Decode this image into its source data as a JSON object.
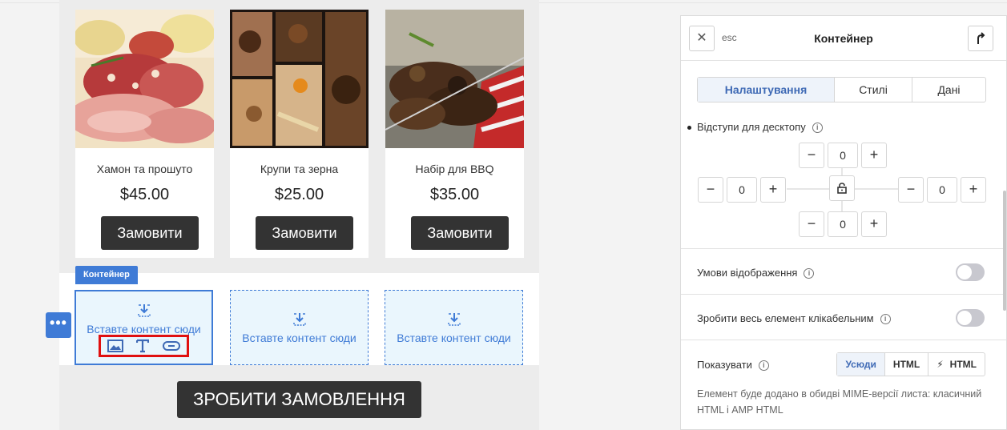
{
  "products": [
    {
      "name": "Хамон та прошуто",
      "price": "$45.00",
      "button": "Замовити"
    },
    {
      "name": "Крупи та зерна",
      "price": "$25.00",
      "button": "Замовити"
    },
    {
      "name": "Набір для BBQ",
      "price": "$35.00",
      "button": "Замовити"
    }
  ],
  "container": {
    "label": "Контейнер",
    "slots": [
      {
        "text": "Вставте контент сюди"
      },
      {
        "text": "Вставте контент сюди"
      },
      {
        "text": "Вставте контент сюди"
      }
    ],
    "dots_label": "•••",
    "tool_icons": [
      "image-icon",
      "text-icon",
      "button-icon"
    ]
  },
  "main_button": "ЗРОБИТИ ЗАМОВЛЕННЯ",
  "panel": {
    "close_label": "✕",
    "esc_label": "esc",
    "title": "Контейнер",
    "tabs": [
      "Налаштування",
      "Стилі",
      "Дані"
    ],
    "active_tab": "Налаштування",
    "padding_title": "Відступи для десктопу",
    "padding": {
      "top": "0",
      "left": "0",
      "right": "0",
      "bottom": "0"
    },
    "minus": "−",
    "plus": "+",
    "display_conditions": "Умови відображення",
    "clickable_element": "Зробити весь елемент клікабельним",
    "show_label": "Показувати",
    "show_options": [
      "Усюди",
      "HTML",
      "HTML"
    ],
    "show_active": "Усюди",
    "note": "Елемент буде додано в обидві MIME-версії листа: класичний HTML і AMP HTML",
    "info": "i",
    "accent": "#3f7bd6",
    "highlight": "#e01010"
  }
}
